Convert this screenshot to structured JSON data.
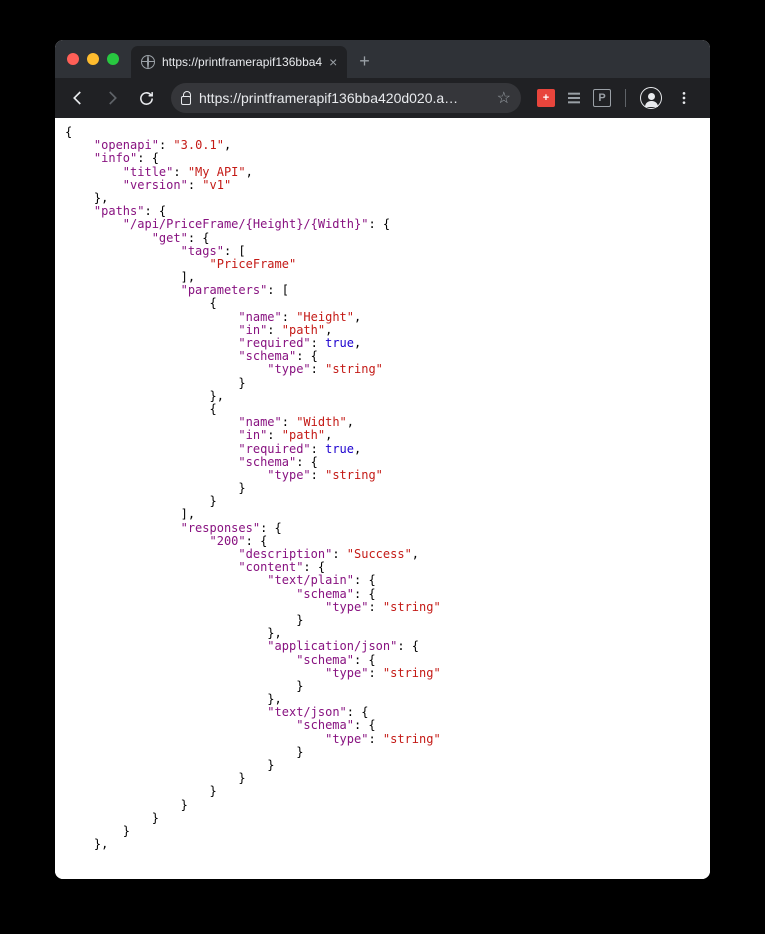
{
  "window": {
    "tab_title": "https://printframerapif136bba4",
    "url_display": "https://printframerapif136bba420d020.a…"
  },
  "json_body": {
    "openapi": "3.0.1",
    "info": {
      "title": "My API",
      "version": "v1"
    },
    "paths": {
      "/api/PriceFrame/{Height}/{Width}": {
        "get": {
          "tags": [
            "PriceFrame"
          ],
          "parameters": [
            {
              "name": "Height",
              "in": "path",
              "required": true,
              "schema": {
                "type": "string"
              }
            },
            {
              "name": "Width",
              "in": "path",
              "required": true,
              "schema": {
                "type": "string"
              }
            }
          ],
          "responses": {
            "200": {
              "description": "Success",
              "content": {
                "text/plain": {
                  "schema": {
                    "type": "string"
                  }
                },
                "application/json": {
                  "schema": {
                    "type": "string"
                  }
                },
                "text/json": {
                  "schema": {
                    "type": "string"
                  }
                }
              }
            }
          }
        }
      }
    }
  }
}
